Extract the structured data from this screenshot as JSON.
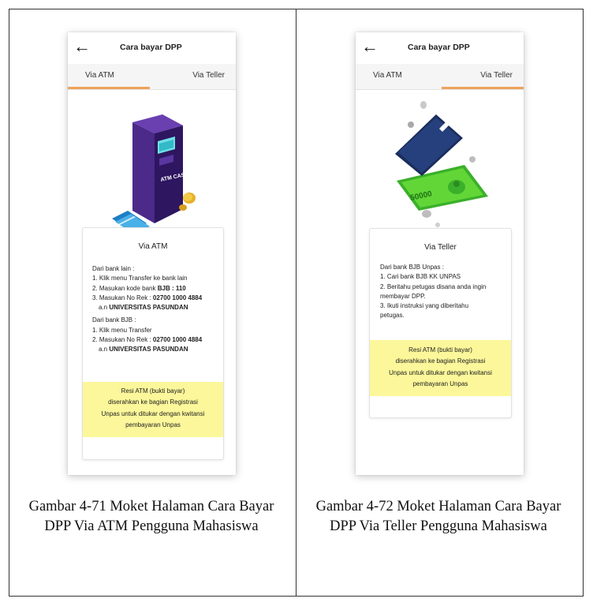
{
  "figures": [
    {
      "app_title": "Cara bayar DPP",
      "tabs": [
        "Via ATM",
        "Via Teller"
      ],
      "active_tab": 0,
      "illustration": "atm-machine-illustration",
      "atm_text": "ATM CASH",
      "card_title": "Via ATM",
      "lines_a": [
        "Dari bank lain :",
        "1. Klik menu Transfer ke bank lain"
      ],
      "line_kode_prefix": "2. Masukan kode bank ",
      "line_kode_bold": "BJB : 110",
      "line_rek1_prefix": "3. Masukan No Rek : ",
      "line_rek1_bold": "02700 1000 4884",
      "line_an1_prefix": "a.n ",
      "line_an1_bold": "UNIVERSITAS PASUNDAN",
      "lines_b": [
        "Dari bank BJB :",
        "1. Klik menu Transfer"
      ],
      "line_rek2_prefix": "2. Masukan No Rek : ",
      "line_rek2_bold": "02700 1000 4884",
      "line_an2_prefix": "a.n ",
      "line_an2_bold": "UNIVERSITAS PASUNDAN",
      "note": [
        "Resi ATM (bukti bayar)",
        "diserahkan ke bagian Registrasi",
        "Unpas untuk ditukar dengan kwitansi",
        "pembayaran Unpas"
      ],
      "caption": "Gambar 4-71 Moket Halaman Cara Bayar DPP Via ATM Pengguna Mahasiswa"
    },
    {
      "app_title": "Cara bayar DPP",
      "tabs": [
        "Via ATM",
        "Via Teller"
      ],
      "active_tab": 1,
      "illustration": "card-and-money-illustration",
      "money_text": "50000",
      "card_title": "Via Teller",
      "lines": [
        "Dari bank BJB Unpas :",
        "1. Cari bank BJB KK UNPAS",
        "2. Beritahu petugas disana anda ingin",
        "membayar DPP.",
        "3. Ikuti instruksi yang diberitahu",
        "petugas."
      ],
      "note": [
        "Resi ATM (bukti bayar)",
        "diserahkan ke bagian Registrasi",
        "Unpas untuk ditukar dengan kwitansi",
        "pembayaran Unpas"
      ],
      "caption": "Gambar 4-72 Moket Halaman Cara Bayar DPP Via Teller Pengguna Mahasiswa"
    }
  ],
  "colors": {
    "tab_indicator": "#f0a35a",
    "note_bg": "#fbf79a",
    "atm_body": "#3f1d73",
    "card_blue": "#25407d",
    "money_green": "#62d637"
  }
}
